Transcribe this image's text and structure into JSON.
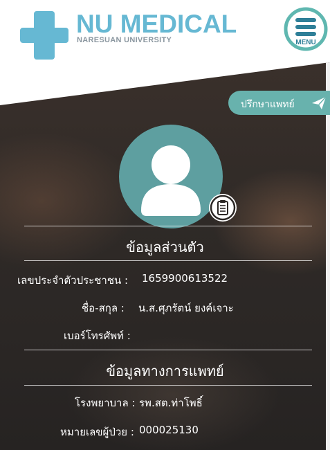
{
  "header": {
    "logo_title": "NU MEDICAL",
    "logo_subtitle": "NARESUAN UNIVERSITY",
    "logo_icon": "medical-cross-icon",
    "menu_label": "MENU",
    "menu_icon": "hamburger-menu-icon"
  },
  "colors": {
    "brand_teal": "#66b8d3",
    "accent_green": "#68b2ad",
    "avatar_teal": "#5e9fa0",
    "panel_dark": "#2f2a27"
  },
  "consult_button": {
    "label": "ปรึกษาแพทย์",
    "icon": "paper-plane-icon"
  },
  "profile": {
    "avatar_icon": "user-avatar-icon",
    "edit_icon": "clipboard-icon"
  },
  "personal_section": {
    "title": "ข้อมูลส่วนตัว",
    "id_label": "เลขประจำตัวประชาชน :",
    "id_value": "1659900613522",
    "name_label": "ชื่อ-สกุล :",
    "name_value": "น.ส.ศุภรัตน์ ยงค์เจาะ",
    "phone_label": "เบอร์โทรศัพท์ :",
    "phone_value": ""
  },
  "medical_section": {
    "title": "ข้อมูลทางการแพทย์",
    "hospital_label": "โรงพยาบาล :",
    "hospital_value": "รพ.สต.ท่าโพธิ์",
    "patient_no_label": "หมายเลขผู้ป่วย :",
    "patient_no_value": "000025130"
  }
}
